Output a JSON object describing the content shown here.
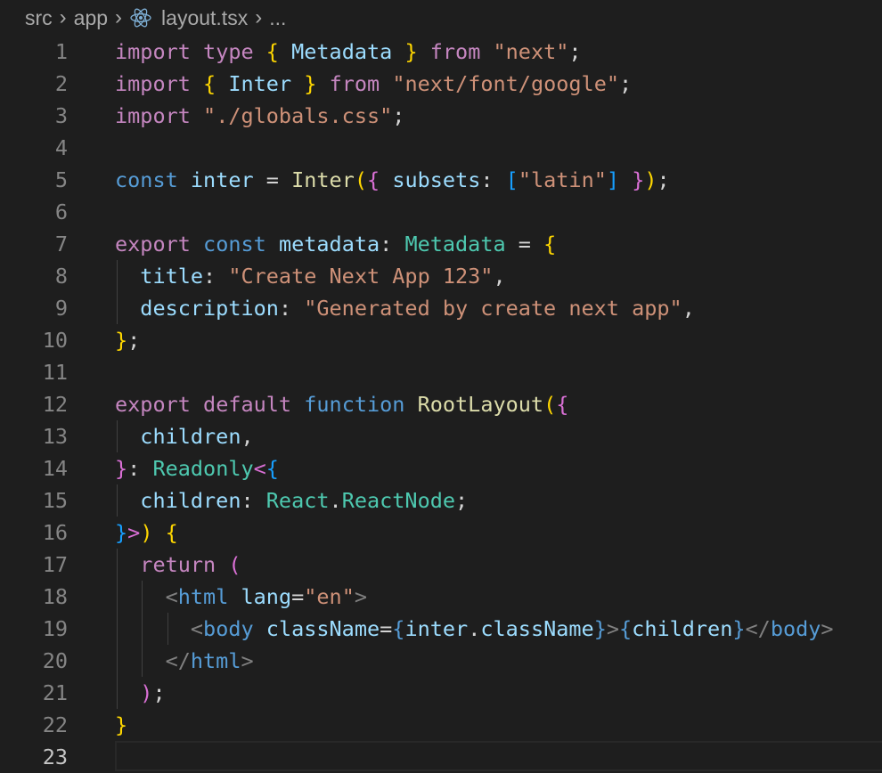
{
  "breadcrumb": {
    "segments": [
      "src",
      "app",
      "layout.tsx",
      "..."
    ],
    "file_icon": "react-icon"
  },
  "editor": {
    "line_numbers": [
      "1",
      "2",
      "3",
      "4",
      "5",
      "6",
      "7",
      "8",
      "9",
      "10",
      "11",
      "12",
      "13",
      "14",
      "15",
      "16",
      "17",
      "18",
      "19",
      "20",
      "21",
      "22",
      "23"
    ],
    "active_line": 23,
    "lines": [
      [
        [
          "kw",
          "import"
        ],
        [
          "tx",
          " "
        ],
        [
          "kw",
          "type"
        ],
        [
          "tx",
          " "
        ],
        [
          "b1",
          "{"
        ],
        [
          "tx",
          " "
        ],
        [
          "vr",
          "Metadata"
        ],
        [
          "tx",
          " "
        ],
        [
          "b1",
          "}"
        ],
        [
          "tx",
          " "
        ],
        [
          "kw",
          "from"
        ],
        [
          "tx",
          " "
        ],
        [
          "s",
          "\"next\""
        ],
        [
          "tx",
          ";"
        ]
      ],
      [
        [
          "kw",
          "import"
        ],
        [
          "tx",
          " "
        ],
        [
          "b1",
          "{"
        ],
        [
          "tx",
          " "
        ],
        [
          "vr",
          "Inter"
        ],
        [
          "tx",
          " "
        ],
        [
          "b1",
          "}"
        ],
        [
          "tx",
          " "
        ],
        [
          "kw",
          "from"
        ],
        [
          "tx",
          " "
        ],
        [
          "s",
          "\"next/font/google\""
        ],
        [
          "tx",
          ";"
        ]
      ],
      [
        [
          "kw",
          "import"
        ],
        [
          "tx",
          " "
        ],
        [
          "s",
          "\"./globals.css\""
        ],
        [
          "tx",
          ";"
        ]
      ],
      [],
      [
        [
          "st",
          "const"
        ],
        [
          "tx",
          " "
        ],
        [
          "vr",
          "inter"
        ],
        [
          "tx",
          " = "
        ],
        [
          "fn",
          "Inter"
        ],
        [
          "b1",
          "("
        ],
        [
          "b2",
          "{"
        ],
        [
          "tx",
          " "
        ],
        [
          "vr",
          "subsets"
        ],
        [
          "tx",
          ": "
        ],
        [
          "b3",
          "["
        ],
        [
          "s",
          "\"latin\""
        ],
        [
          "b3",
          "]"
        ],
        [
          "tx",
          " "
        ],
        [
          "b2",
          "}"
        ],
        [
          "b1",
          ")"
        ],
        [
          "tx",
          ";"
        ]
      ],
      [],
      [
        [
          "kw",
          "export"
        ],
        [
          "tx",
          " "
        ],
        [
          "st",
          "const"
        ],
        [
          "tx",
          " "
        ],
        [
          "vr",
          "metadata"
        ],
        [
          "tx",
          ": "
        ],
        [
          "ty",
          "Metadata"
        ],
        [
          "tx",
          " = "
        ],
        [
          "b1",
          "{"
        ]
      ],
      [
        [
          "tx",
          "  "
        ],
        [
          "vr",
          "title"
        ],
        [
          "tx",
          ": "
        ],
        [
          "s",
          "\"Create Next App 123\""
        ],
        [
          "tx",
          ","
        ]
      ],
      [
        [
          "tx",
          "  "
        ],
        [
          "vr",
          "description"
        ],
        [
          "tx",
          ": "
        ],
        [
          "s",
          "\"Generated by create next app\""
        ],
        [
          "tx",
          ","
        ]
      ],
      [
        [
          "b1",
          "}"
        ],
        [
          "tx",
          ";"
        ]
      ],
      [],
      [
        [
          "kw",
          "export"
        ],
        [
          "tx",
          " "
        ],
        [
          "kw",
          "default"
        ],
        [
          "tx",
          " "
        ],
        [
          "st",
          "function"
        ],
        [
          "tx",
          " "
        ],
        [
          "fn",
          "RootLayout"
        ],
        [
          "b1",
          "("
        ],
        [
          "b2",
          "{"
        ]
      ],
      [
        [
          "tx",
          "  "
        ],
        [
          "vr",
          "children"
        ],
        [
          "tx",
          ","
        ]
      ],
      [
        [
          "b2",
          "}"
        ],
        [
          "tx",
          ": "
        ],
        [
          "ty",
          "Readonly"
        ],
        [
          "b2",
          "<"
        ],
        [
          "b3",
          "{"
        ]
      ],
      [
        [
          "tx",
          "  "
        ],
        [
          "vr",
          "children"
        ],
        [
          "tx",
          ": "
        ],
        [
          "ty",
          "React"
        ],
        [
          "tx",
          "."
        ],
        [
          "ty",
          "ReactNode"
        ],
        [
          "tx",
          ";"
        ]
      ],
      [
        [
          "b3",
          "}"
        ],
        [
          "b2",
          ">"
        ],
        [
          "b1",
          ")"
        ],
        [
          "tx",
          " "
        ],
        [
          "b1",
          "{"
        ]
      ],
      [
        [
          "tx",
          "  "
        ],
        [
          "kw",
          "return"
        ],
        [
          "tx",
          " "
        ],
        [
          "b2",
          "("
        ]
      ],
      [
        [
          "tx",
          "    "
        ],
        [
          "pu",
          "<"
        ],
        [
          "tg",
          "html"
        ],
        [
          "tx",
          " "
        ],
        [
          "vr",
          "lang"
        ],
        [
          "tx",
          "="
        ],
        [
          "s",
          "\"en\""
        ],
        [
          "pu",
          ">"
        ]
      ],
      [
        [
          "tx",
          "      "
        ],
        [
          "pu",
          "<"
        ],
        [
          "tg",
          "body"
        ],
        [
          "tx",
          " "
        ],
        [
          "vr",
          "className"
        ],
        [
          "tx",
          "="
        ],
        [
          "st",
          "{"
        ],
        [
          "vr",
          "inter"
        ],
        [
          "tx",
          "."
        ],
        [
          "vr",
          "className"
        ],
        [
          "st",
          "}"
        ],
        [
          "pu",
          ">"
        ],
        [
          "st",
          "{"
        ],
        [
          "vr",
          "children"
        ],
        [
          "st",
          "}"
        ],
        [
          "pu",
          "</"
        ],
        [
          "tg",
          "body"
        ],
        [
          "pu",
          ">"
        ]
      ],
      [
        [
          "tx",
          "    "
        ],
        [
          "pu",
          "</"
        ],
        [
          "tg",
          "html"
        ],
        [
          "pu",
          ">"
        ]
      ],
      [
        [
          "tx",
          "  "
        ],
        [
          "b2",
          ")"
        ],
        [
          "tx",
          ";"
        ]
      ],
      [
        [
          "b1",
          "}"
        ]
      ],
      []
    ]
  }
}
